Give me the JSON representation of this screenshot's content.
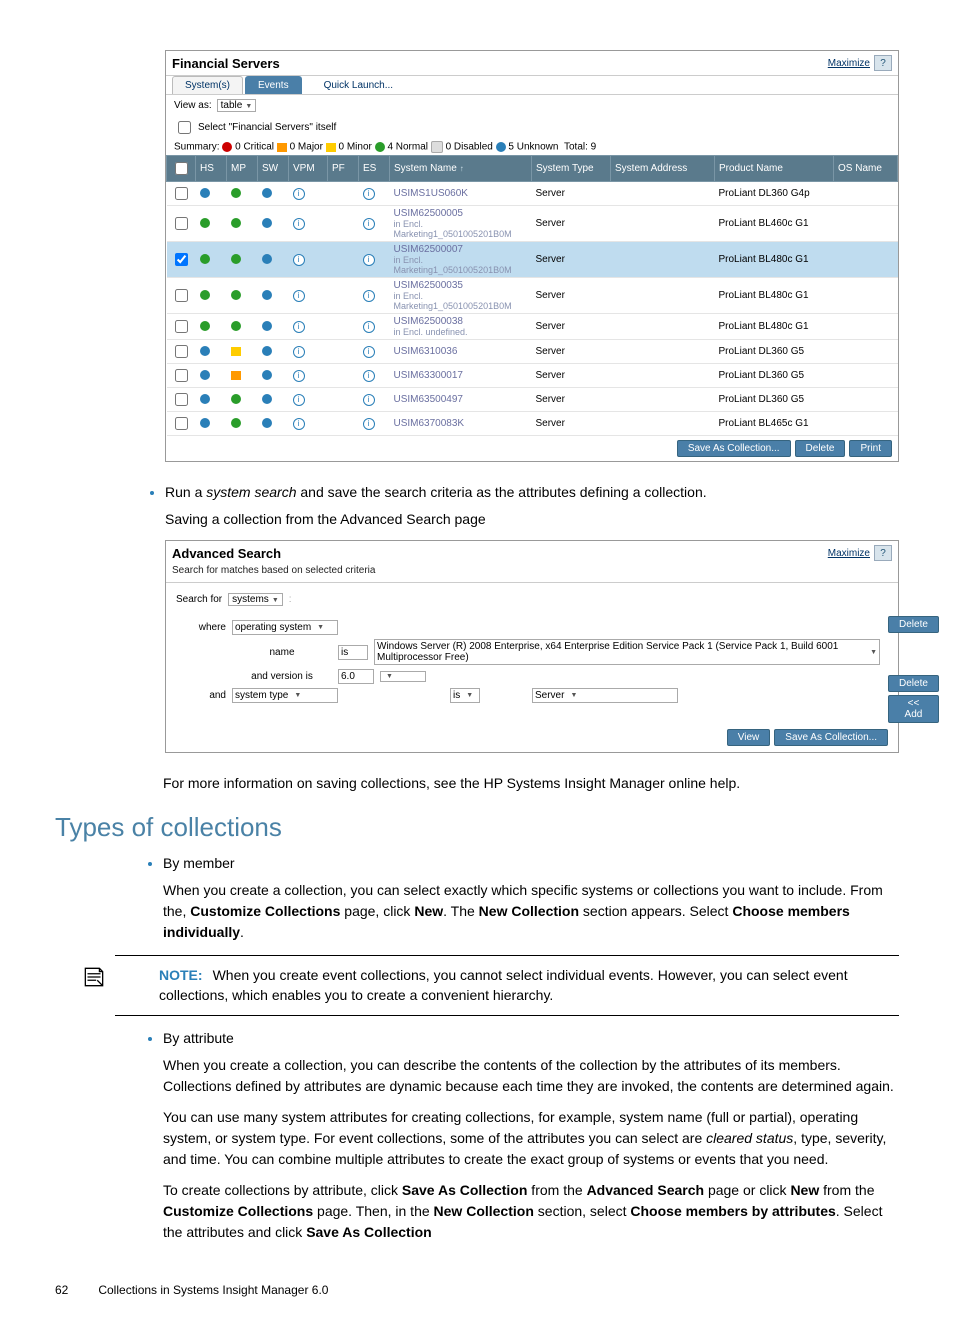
{
  "fs_panel": {
    "title": "Financial Servers",
    "maximize": "Maximize",
    "help": "?",
    "tabs": [
      "System(s)",
      "Events"
    ],
    "quick_launch": "Quick Launch...",
    "view_as_label": "View as:",
    "view_as_value": "table",
    "select_itself": "Select \"Financial Servers\" itself",
    "summary_prefix": "Summary:",
    "summary": {
      "critical": "0 Critical",
      "major": "0 Major",
      "minor": "0 Minor",
      "normal": "4 Normal",
      "disabled": "0 Disabled",
      "unknown": "5 Unknown",
      "total": "Total: 9"
    },
    "cols": [
      "",
      "HS",
      "MP",
      "SW",
      "VPM",
      "PF",
      "ES",
      "System Name",
      "System Type",
      "System Address",
      "Product Name",
      "OS Name"
    ],
    "btns": {
      "save": "Save As Collection...",
      "delete": "Delete",
      "print": "Print"
    },
    "rows": [
      {
        "hs": "unknown",
        "mp": "normal",
        "sw": "unknown",
        "vpm": "info",
        "pf": "",
        "es": "info",
        "name": "USIMS1US060K",
        "sub": "",
        "type": "Server",
        "addr": "",
        "prod": "ProLiant DL360 G4p",
        "os": ""
      },
      {
        "hs": "normal",
        "mp": "normal",
        "sw": "unknown",
        "vpm": "info",
        "pf": "",
        "es": "info",
        "name": "USIM62500005",
        "sub": "in Encl. Marketing1_0501005201B0M",
        "type": "Server",
        "addr": "",
        "prod": "ProLiant BL460c G1",
        "os": ""
      },
      {
        "hs": "normal",
        "mp": "normal",
        "sw": "unknown",
        "vpm": "info",
        "pf": "",
        "es": "info",
        "name": "USIM62500007",
        "sub": "in Encl. Marketing1_0501005201B0M",
        "type": "Server",
        "addr": "",
        "prod": "ProLiant BL480c G1",
        "os": ""
      },
      {
        "hs": "normal",
        "mp": "normal",
        "sw": "unknown",
        "vpm": "info",
        "pf": "",
        "es": "info",
        "name": "USIM62500035",
        "sub": "in Encl. Marketing1_0501005201B0M",
        "type": "Server",
        "addr": "",
        "prod": "ProLiant BL480c G1",
        "os": ""
      },
      {
        "hs": "normal",
        "mp": "normal",
        "sw": "unknown",
        "vpm": "info",
        "pf": "",
        "es": "info",
        "name": "USIM62500038",
        "sub": "in Encl. undefined.",
        "type": "Server",
        "addr": "",
        "prod": "ProLiant BL480c G1",
        "os": ""
      },
      {
        "hs": "unknown",
        "mp": "minor",
        "sw": "unknown",
        "vpm": "info",
        "pf": "",
        "es": "info",
        "name": "USIM6310036",
        "sub": "",
        "type": "Server",
        "addr": "",
        "prod": "ProLiant DL360 G5",
        "os": ""
      },
      {
        "hs": "unknown",
        "mp": "major",
        "sw": "unknown",
        "vpm": "info",
        "pf": "",
        "es": "info",
        "name": "USIM63300017",
        "sub": "",
        "type": "Server",
        "addr": "",
        "prod": "ProLiant DL360 G5",
        "os": ""
      },
      {
        "hs": "unknown",
        "mp": "normal",
        "sw": "unknown",
        "vpm": "info",
        "pf": "",
        "es": "info",
        "name": "USIM63500497",
        "sub": "",
        "type": "Server",
        "addr": "",
        "prod": "ProLiant DL360 G5",
        "os": ""
      },
      {
        "hs": "unknown",
        "mp": "normal",
        "sw": "unknown",
        "vpm": "info",
        "pf": "",
        "es": "info",
        "name": "USIM6370083K",
        "sub": "",
        "type": "Server",
        "addr": "",
        "prod": "ProLiant BL465c G1",
        "os": ""
      }
    ]
  },
  "body": {
    "run_search_pre": "Run a ",
    "run_search_em": "system search",
    "run_search_post": " and save the search criteria as the attributes defining a collection.",
    "caption": "Saving a collection from the Advanced Search page"
  },
  "adv_panel": {
    "title": "Advanced Search",
    "subtitle": "Search for matches based on selected criteria",
    "maximize": "Maximize",
    "help": "?",
    "search_for": "Search for",
    "search_for_value": "systems",
    "where": "where",
    "row1_field": "operating system",
    "row2_field": "name",
    "row2_op": "is",
    "row2_value": "Windows Server (R) 2008 Enterprise, x64 Enterprise Edition Service Pack 1 (Service Pack 1, Build 6001 Multiprocessor Free)",
    "row3_field": "and version is",
    "row3_value": "6.0",
    "and": "and",
    "row4_field": "system type",
    "row4_op": "is",
    "row4_value": "Server",
    "btns": {
      "delete": "Delete",
      "add": "<< Add",
      "view": "View",
      "save": "Save As Collection..."
    }
  },
  "text": {
    "more_info": "For more information on saving collections, see the HP Systems Insight Manager online help.",
    "section_title": "Types of collections",
    "by_member": "By member",
    "by_member_body_1": "When you create a collection, you can select exactly which specific systems or collections you want to include. From the, ",
    "by_member_b1": "Customize Collections",
    "by_member_body_2": " page, click ",
    "by_member_b2": "New",
    "by_member_body_3": ". The ",
    "by_member_b3": "New Collection",
    "by_member_body_4": " section appears. Select ",
    "by_member_b4": "Choose members individually",
    "by_member_body_5": ".",
    "note_label": "NOTE:",
    "note_body": "When you create event collections, you cannot select individual events. However, you can select event collections, which enables you to create a convenient hierarchy.",
    "by_attr": "By attribute",
    "by_attr_p1": "When you create a collection, you can describe the contents of the collection by the attributes of its members. Collections defined by attributes are dynamic because each time they are invoked, the contents are determined again.",
    "by_attr_p2_a": "You can use many system attributes for creating collections, for example, system name (full or partial), operating system, or system type. For event collections, some of the attributes you can select are ",
    "by_attr_p2_em": "cleared status",
    "by_attr_p2_b": ", type, severity, and time. You can combine multiple attributes to create the exact group of systems or events that you need.",
    "by_attr_p3_a": "To create collections by attribute, click ",
    "by_attr_p3_b1": "Save As Collection",
    "by_attr_p3_b": " from the ",
    "by_attr_p3_b2": "Advanced Search",
    "by_attr_p3_c": " page or click ",
    "by_attr_p3_b3": "New",
    "by_attr_p3_d": " from the ",
    "by_attr_p3_b4": "Customize Collections",
    "by_attr_p3_e": " page. Then, in the ",
    "by_attr_p3_b5": "New Collection",
    "by_attr_p3_f": " section, select ",
    "by_attr_p3_b6": "Choose members by attributes",
    "by_attr_p3_g": ". Select the attributes and click ",
    "by_attr_p3_b7": "Save As Collection",
    "footer_page": "62",
    "footer_text": "Collections in Systems Insight Manager 6.0"
  }
}
